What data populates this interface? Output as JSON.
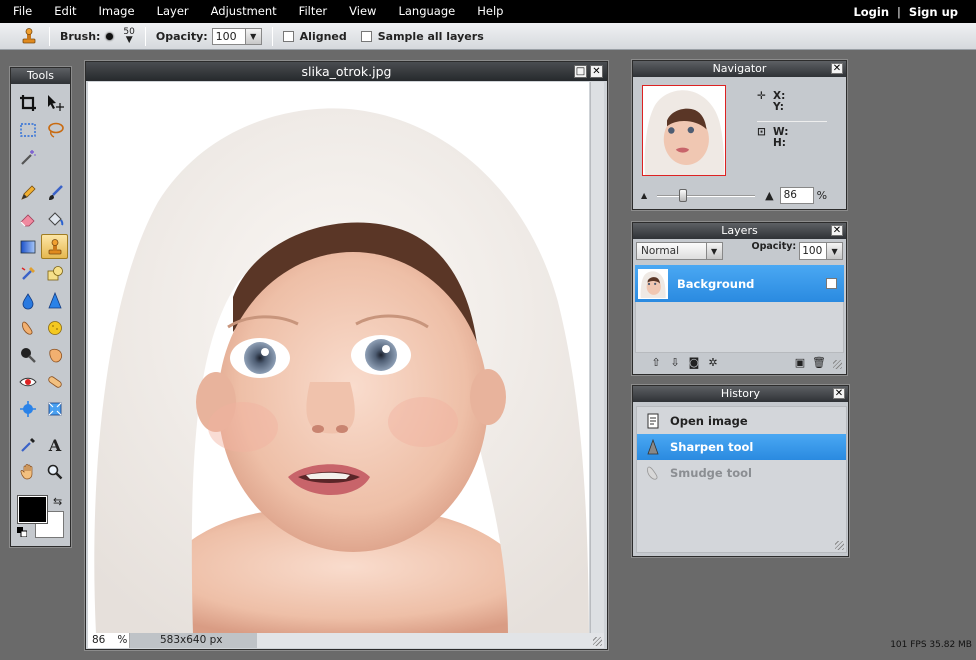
{
  "menu": {
    "items": [
      "File",
      "Edit",
      "Image",
      "Layer",
      "Adjustment",
      "Filter",
      "View",
      "Language",
      "Help"
    ],
    "login": "Login",
    "separator": "|",
    "signup": "Sign up"
  },
  "options": {
    "brush_label": "Brush:",
    "brush_size": "50",
    "opacity_label": "Opacity:",
    "opacity_value": "100",
    "aligned_label": "Aligned",
    "sample_all_label": "Sample all layers"
  },
  "tools": {
    "title": "Tools",
    "active_tool": "clone-stamp",
    "foreground_color": "#000000",
    "background_color": "#ffffff"
  },
  "document": {
    "title": "slika_otrok.jpg",
    "zoom": "86",
    "zoom_unit": "%",
    "dimensions": "583x640 px"
  },
  "navigator": {
    "title": "Navigator",
    "x_label": "X:",
    "y_label": "Y:",
    "w_label": "W:",
    "h_label": "H:",
    "zoom_value": "86",
    "zoom_unit": "%"
  },
  "layers": {
    "title": "Layers",
    "blend_mode": "Normal",
    "opacity_label": "Opacity:",
    "opacity_value": "100",
    "items": [
      {
        "name": "Background",
        "locked": true,
        "selected": true
      }
    ]
  },
  "history": {
    "title": "History",
    "items": [
      {
        "label": "Open image",
        "state": "normal"
      },
      {
        "label": "Sharpen tool",
        "state": "active"
      },
      {
        "label": "Smudge tool",
        "state": "disabled"
      }
    ]
  },
  "status": {
    "fps": "101 FPS 35.82 MB"
  },
  "colors": {
    "accent": "#2a8ae0",
    "menubar": "#000000",
    "workspace": "#6a6a6a"
  }
}
